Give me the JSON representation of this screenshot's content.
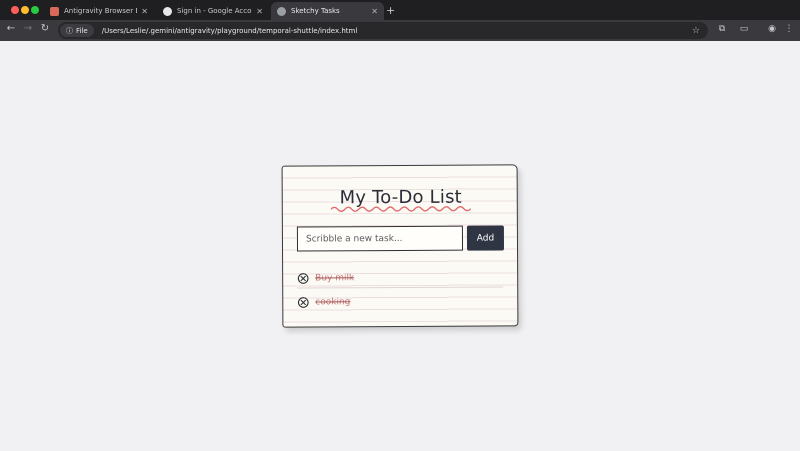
{
  "browser": {
    "tabs": [
      {
        "title": "Antigravity Browser Extension",
        "favicon_color": "#d96a5a",
        "active": false
      },
      {
        "title": "Sign in - Google Accounts",
        "favicon_color": "#e8e8ea",
        "active": false
      },
      {
        "title": "Sketchy Tasks",
        "favicon_color": "#9aa0a6",
        "active": true
      }
    ],
    "address_chip": "File",
    "url": "/Users/Leslie/.gemini/antigravity/playground/temporal-shuttle/index.html",
    "icons": {
      "back": "back-arrow-icon",
      "forward": "forward-arrow-icon",
      "reload": "reload-icon",
      "info": "info-icon",
      "bookmark": "star-icon",
      "extensions": "puzzle-icon",
      "cast": "cast-icon",
      "profile": "profile-icon",
      "menu": "kebab-menu-icon"
    }
  },
  "app": {
    "title": "My To-Do List",
    "input_placeholder": "Scribble a new task...",
    "add_label": "Add",
    "tasks": [
      {
        "text": "Buy milk",
        "completed": true
      },
      {
        "text": "cooking",
        "completed": true
      }
    ],
    "colors": {
      "accent": "#2f3542",
      "completed_text": "#c97b7b",
      "squiggle": "#e06a6a"
    }
  }
}
